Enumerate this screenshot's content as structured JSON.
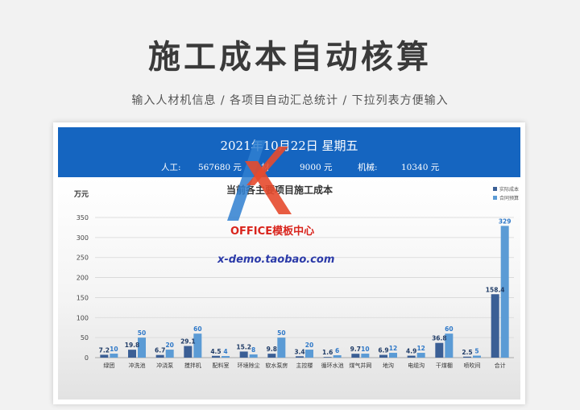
{
  "page": {
    "title": "施工成本自动核算",
    "subtitle": "输入人材机信息 / 各项目自动汇总统计 / 下拉列表方便输入"
  },
  "banner": {
    "date": "2021年10月22日  星期五",
    "labor_label": "人工:",
    "labor_value": "567680 元",
    "material_label": "材",
    "material_value": "9000 元",
    "machine_label": "机械:",
    "machine_value": "10340 元"
  },
  "watermark": {
    "brand": "OFFICE模板中心",
    "url": "x-demo.taobao.com"
  },
  "chart_data": {
    "type": "bar",
    "title": "当前各主要项目施工成本",
    "ylabel": "万元",
    "ylim": [
      0,
      350
    ],
    "yticks": [
      "0",
      "50",
      "100",
      "150",
      "200",
      "250",
      "300",
      "350"
    ],
    "legend_position": "top-right",
    "categories": [
      "绿团",
      "冲洗池",
      "冲浇泵",
      "搅拌机",
      "配料室",
      "环境除尘",
      "软水泵房",
      "主控楼",
      "循环水池",
      "煤气井网",
      "地沟",
      "电缆沟",
      "干煤棚",
      "喷吹间",
      "合计"
    ],
    "series": [
      {
        "name": "实际成本",
        "color": "#3b5f95",
        "values": [
          7.2,
          19.8,
          6.7,
          29.1,
          4.5,
          15.2,
          9.8,
          3.4,
          1.6,
          9.7,
          6.9,
          4.9,
          36.8,
          2.5,
          158.4
        ],
        "labels": [
          "7.2",
          "19.8",
          "6.7",
          "29.1",
          "4.5",
          "15.2",
          "9.8",
          "3.4",
          "1.6",
          "9.7",
          "6.9",
          "4.9",
          "36.8",
          "2.5",
          "158.4"
        ]
      },
      {
        "name": "合同预算",
        "color": "#5b9bd5",
        "values": [
          10,
          50,
          20,
          60,
          4,
          8,
          50,
          20,
          6,
          10,
          12,
          12,
          60,
          5,
          329
        ],
        "labels": [
          "10",
          "50",
          "20",
          "60",
          "4",
          "8",
          "50",
          "20",
          "6",
          "10",
          "12",
          "12",
          "60",
          "5",
          "329"
        ]
      }
    ]
  }
}
